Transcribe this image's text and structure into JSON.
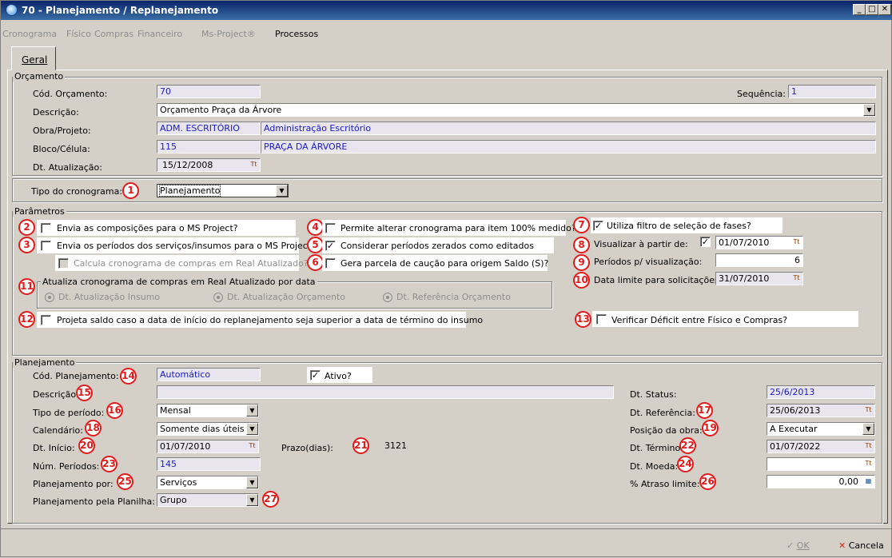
{
  "window": {
    "title": "70 - Planejamento / Replanejamento"
  },
  "menu": [
    "Cronograma",
    "Físico",
    "Compras",
    "Financeiro",
    "Ms-Project®",
    "Processos"
  ],
  "tab": {
    "label": "Geral"
  },
  "orcamento": {
    "group_label": "Orçamento",
    "cod_label": "Cód. Orçamento:",
    "cod_value": "70",
    "seq_label": "Sequência:",
    "seq_value": "1",
    "desc_label": "Descrição:",
    "desc_value": "Orçamento Praça da Árvore",
    "obra_label": "Obra/Projeto:",
    "obra_code": "ADM. ESCRITÓRIO",
    "obra_name": "Administração Escritório",
    "bloco_label": "Bloco/Célula:",
    "bloco_code": "115",
    "bloco_name": "PRAÇA DA ÁRVORE",
    "dt_label": "Dt. Atualização:",
    "dt_value": "15/12/2008"
  },
  "tipo": {
    "label": "Tipo do cronograma:",
    "value": "Planejamento"
  },
  "parametros": {
    "group_label": "Parâmetros",
    "p2": "Envia as composições para  o MS Project?",
    "p3": "Envia os períodos dos serviços/insumos para o MS Project?",
    "calc": "Calcula cronograma de compras em Real Atualizado?",
    "p4": "Permite alterar cronograma para item 100% medido?",
    "p5": "Considerar períodos zerados como editados",
    "p6": "Gera parcela de caução para origem Saldo (S)?",
    "p7": "Utiliza filtro de seleção de fases?",
    "p8_label": "Visualizar à partir de:",
    "p8_date": "01/07/2010",
    "p9_label": "Períodos p/ visualização:",
    "p9_value": "6",
    "p10_label": "Data limite para solicitações:",
    "p10_value": "31/07/2010",
    "p11_label": "Atualiza cronograma de compras em Real Atualizado por data",
    "r1": "Dt. Atualização Insumo",
    "r2": "Dt. Atualização Orçamento",
    "r3": "Dt. Referência Orçamento",
    "p12": "Projeta saldo caso a data de início do replanejamento seja superior a data de término do insumo",
    "p13": "Verificar Déficit entre Físico e Compras?"
  },
  "planejamento": {
    "group_label": "Planejamento",
    "cod_label": "Cód. Planejamento:",
    "cod_value": "Automático",
    "ativo": "Ativo?",
    "desc_label": "Descrição:",
    "desc_value": "",
    "tipo_label": "Tipo de período:",
    "tipo_value": "Mensal",
    "cal_label": "Calendário:",
    "cal_value": "Somente dias úteis",
    "inicio_label": "Dt. Início:",
    "inicio_value": "01/07/2010",
    "prazo_label": "Prazo(dias):",
    "prazo_value": "3121",
    "num_label": "Núm. Períodos:",
    "num_value": "145",
    "por_label": "Planejamento por:",
    "por_value": "Serviços",
    "planilha_label": "Planejamento pela Planilha:",
    "planilha_value": "Grupo",
    "status_label": "Dt. Status:",
    "status_value": "25/6/2013",
    "ref_label": "Dt. Referência:",
    "ref_value": "25/06/2013",
    "pos_label": "Posição da obra:",
    "pos_value": "A Executar",
    "termino_label": "Dt. Término:",
    "termino_value": "01/07/2022",
    "moeda_label": "Dt. Moeda:",
    "moeda_value": "",
    "atraso_label": "% Atraso limite:",
    "atraso_value": "0,00"
  },
  "badges": [
    "1",
    "2",
    "3",
    "4",
    "5",
    "6",
    "7",
    "8",
    "9",
    "10",
    "11",
    "12",
    "13",
    "14",
    "15",
    "16",
    "17",
    "18",
    "19",
    "20",
    "21",
    "22",
    "23",
    "24",
    "25",
    "26",
    "27"
  ],
  "buttons": {
    "ok": "OK",
    "cancel": "Cancela"
  }
}
